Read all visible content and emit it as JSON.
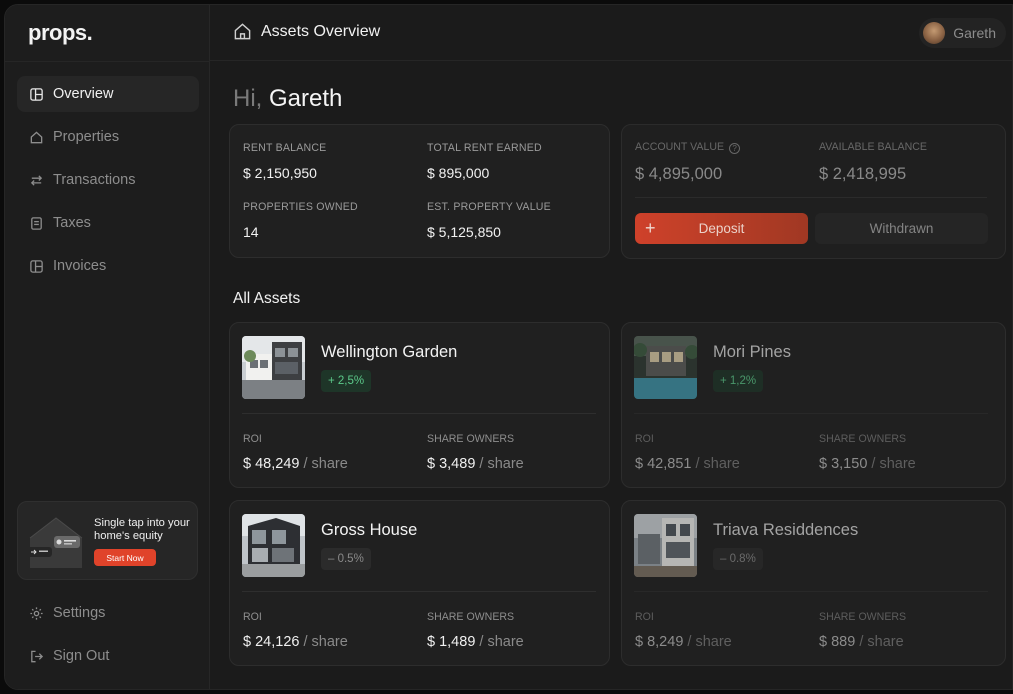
{
  "app": {
    "logo": "props."
  },
  "sidebar": {
    "items": [
      {
        "label": "Overview",
        "icon": "layout-icon",
        "active": true
      },
      {
        "label": "Properties",
        "icon": "home-icon"
      },
      {
        "label": "Transactions",
        "icon": "arrows-icon"
      },
      {
        "label": "Taxes",
        "icon": "receipt-icon"
      },
      {
        "label": "Invoices",
        "icon": "invoice-icon"
      }
    ],
    "promo": {
      "text": "Single tap into your home's equity",
      "button": "Start Now"
    },
    "bottom": [
      {
        "label": "Settings",
        "icon": "gear-icon"
      },
      {
        "label": "Sign Out",
        "icon": "sign-out-icon"
      }
    ]
  },
  "header": {
    "title": "Assets Overview",
    "user_name": "Gareth"
  },
  "greeting": {
    "hi": "Hi,",
    "name": "Gareth"
  },
  "summary": {
    "rent_balance_label": "RENT BALANCE",
    "rent_balance": "$ 2,150,950",
    "total_rent_label": "TOTAL RENT EARNED",
    "total_rent": "$ 895,000",
    "properties_owned_label": "PROPERTIES OWNED",
    "properties_owned": "14",
    "est_value_label": "EST. PROPERTY VALUE",
    "est_value": "$ 5,125,850"
  },
  "account": {
    "account_value_label": "ACCOUNT VALUE",
    "account_value": "$ 4,895,000",
    "available_label": "AVAILABLE BALANCE",
    "available": "$ 2,418,995",
    "deposit_label": "Deposit",
    "withdraw_label": "Withdrawn"
  },
  "assets": {
    "title": "All Assets",
    "roi_label": "ROI",
    "owners_label": "SHARE OWNERS",
    "unit": "/ share",
    "items": [
      {
        "name": "Wellington Garden",
        "change": "+ 2,5%",
        "trend": "up",
        "roi": "$ 48,249",
        "owners": "$ 3,489"
      },
      {
        "name": "Mori Pines",
        "change": "+ 1,2%",
        "trend": "up",
        "roi": "$ 42,851",
        "owners": "$ 3,150"
      },
      {
        "name": "Gross House",
        "change": "– 0.5%",
        "trend": "down",
        "roi": "$ 24,126",
        "owners": "$ 1,489"
      },
      {
        "name": "Triava Residdences",
        "change": "– 0.8%",
        "trend": "down",
        "roi": "$ 8,249",
        "owners": "$ 889"
      }
    ]
  },
  "colors": {
    "accent": "#e0432a",
    "positive": "#5cc98a",
    "background": "#1b1b1b"
  }
}
